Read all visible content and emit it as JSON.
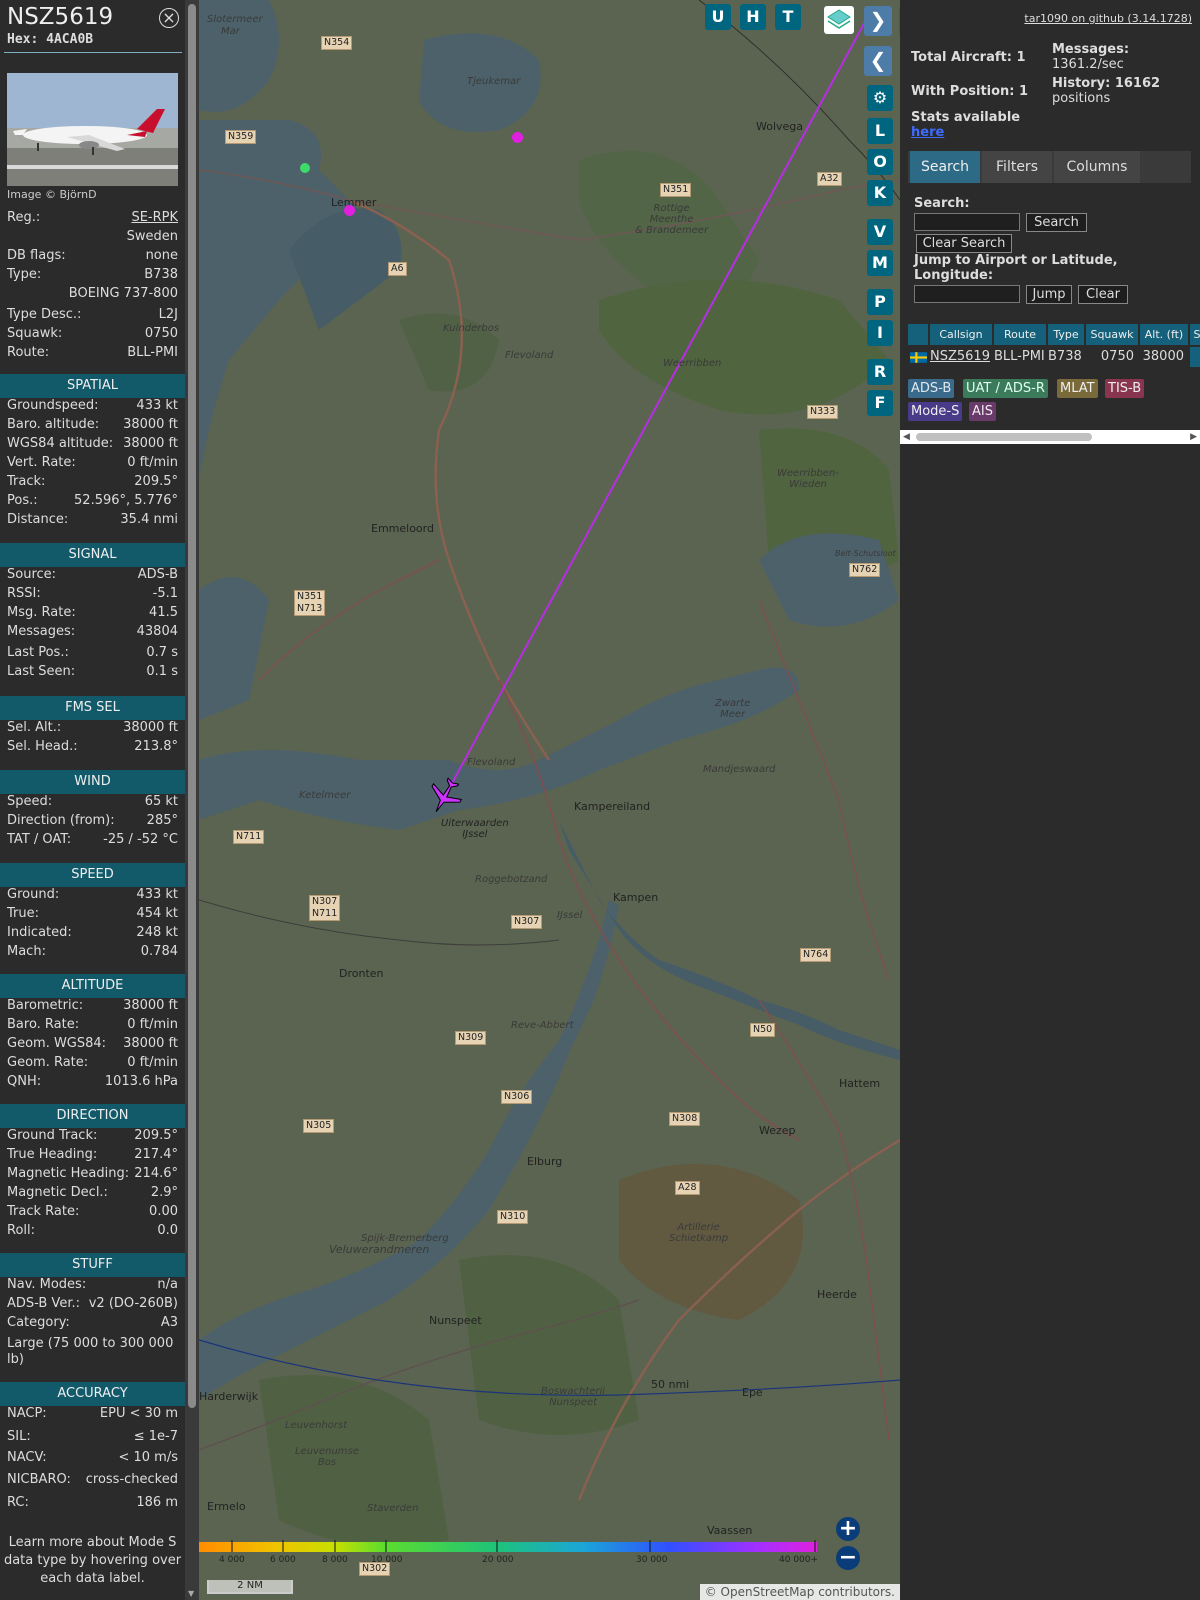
{
  "aircraft": {
    "callsign": "NSZ5619",
    "hex_label": "Hex: 4ACA0B",
    "image_credit": "Image © BjörnD",
    "close_icon": "circle-x-icon"
  },
  "info_rows": [
    {
      "k": "Reg.:",
      "v": "SE-RPK"
    },
    {
      "k": "",
      "v": "Sweden"
    },
    {
      "k": "DB flags:",
      "v": "none"
    },
    {
      "k": "Type:",
      "v": "B738"
    },
    {
      "k": "",
      "v": "BOEING 737-800"
    },
    {
      "k": "Type Desc.:",
      "v": "L2J"
    },
    {
      "k": "Squawk:",
      "v": "0750"
    },
    {
      "k": "Route:",
      "v": "BLL-PMI"
    }
  ],
  "sections": {
    "spatial": {
      "title": "SPATIAL",
      "rows": [
        {
          "k": "Groundspeed:",
          "v": "433 kt"
        },
        {
          "k": "Baro. altitude:",
          "v": "38000 ft"
        },
        {
          "k": "WGS84 altitude:",
          "v": "38000 ft"
        },
        {
          "k": "Vert. Rate:",
          "v": "0 ft/min"
        },
        {
          "k": "Track:",
          "v": "209.5°"
        },
        {
          "k": "Pos.:",
          "v": "52.596°, 5.776°"
        },
        {
          "k": "Distance:",
          "v": "35.4 nmi"
        }
      ]
    },
    "signal": {
      "title": "SIGNAL",
      "rows": [
        {
          "k": "Source:",
          "v": "ADS-B"
        },
        {
          "k": "RSSI:",
          "v": "-5.1"
        },
        {
          "k": "Msg. Rate:",
          "v": "41.5"
        },
        {
          "k": "Messages:",
          "v": "43804"
        },
        {
          "k": "Last Pos.:",
          "v": "0.7 s"
        },
        {
          "k": "Last Seen:",
          "v": "0.1 s"
        }
      ]
    },
    "fms": {
      "title": "FMS SEL",
      "rows": [
        {
          "k": "Sel. Alt.:",
          "v": "38000 ft"
        },
        {
          "k": "Sel. Head.:",
          "v": "213.8°"
        }
      ]
    },
    "wind": {
      "title": "WIND",
      "rows": [
        {
          "k": "Speed:",
          "v": "65 kt"
        },
        {
          "k": "Direction (from):",
          "v": "285°"
        },
        {
          "k": "TAT / OAT:",
          "v": "-25 / -52 °C"
        }
      ]
    },
    "speed": {
      "title": "SPEED",
      "rows": [
        {
          "k": "Ground:",
          "v": "433 kt"
        },
        {
          "k": "True:",
          "v": "454 kt"
        },
        {
          "k": "Indicated:",
          "v": "248 kt"
        },
        {
          "k": "Mach:",
          "v": "0.784"
        }
      ]
    },
    "altitude": {
      "title": "ALTITUDE",
      "rows": [
        {
          "k": "Barometric:",
          "v": "38000 ft"
        },
        {
          "k": "Baro. Rate:",
          "v": "0 ft/min"
        },
        {
          "k": "Geom. WGS84:",
          "v": "38000 ft"
        },
        {
          "k": "Geom. Rate:",
          "v": "0 ft/min"
        },
        {
          "k": "QNH:",
          "v": "1013.6 hPa"
        }
      ]
    },
    "direction": {
      "title": "DIRECTION",
      "rows": [
        {
          "k": "Ground Track:",
          "v": "209.5°"
        },
        {
          "k": "True Heading:",
          "v": "217.4°"
        },
        {
          "k": "Magnetic Heading:",
          "v": "214.6°"
        },
        {
          "k": "Magnetic Decl.:",
          "v": "2.9°"
        },
        {
          "k": "Track Rate:",
          "v": "0.00"
        },
        {
          "k": "Roll:",
          "v": "0.0"
        }
      ]
    },
    "stuff": {
      "title": "STUFF",
      "rows": [
        {
          "k": "Nav. Modes:",
          "v": "n/a"
        },
        {
          "k": "ADS-B Ver.:",
          "v": "v2 (DO-260B)"
        },
        {
          "k": "Category:",
          "v": "A3"
        }
      ],
      "category_desc": "Large (75 000 to 300 000 lb)"
    },
    "accuracy": {
      "title": "ACCURACY",
      "rows": [
        {
          "k": "NACP:",
          "v": "EPU < 30 m"
        },
        {
          "k": "SIL:",
          "v": "≤ 1e-7"
        },
        {
          "k": "NACV:",
          "v": "< 10 m/s"
        },
        {
          "k": "NICBARO:",
          "v": "cross-checked"
        },
        {
          "k": "RC:",
          "v": "186 m"
        }
      ]
    }
  },
  "footnote": "Learn more about Mode S data type by hovering over each data label.",
  "map": {
    "buttons": [
      "U",
      "H",
      "T",
      "L",
      "O",
      "K",
      "V",
      "M",
      "P",
      "I",
      "R",
      "F"
    ],
    "layers_icon": "layers-icon",
    "nav_next_icon": "chevron-right-icon",
    "nav_prev_icon": "chevron-left-icon",
    "expand_icon": "expand-horizontal-icon",
    "settings_icon": "gear-icon",
    "zoom_in_icon": "plus-icon",
    "zoom_out_icon": "minus-icon",
    "aircraft_icon": "airplane-icon",
    "range_ring_label": "50 nmi",
    "scale_label": "2 NM",
    "attribution": "© OpenStreetMap contributors.",
    "attribution_link": "OpenStreetMap",
    "altitude_scale": [
      "4 000",
      "6 000",
      "8 000",
      "10 000",
      "20 000",
      "30 000",
      "40 000+"
    ],
    "places": [
      "Slotermeer",
      "Mar",
      "Tjeukemar",
      "Wolvega",
      "Lemmer",
      "Kuinderbos",
      "Flevoland",
      "Weerribben",
      "Rottige Meenthe & Brandemeer",
      "Weerribben-Wieden",
      "Emmeloord",
      "Belt-Schutsloot",
      "Zwarte Meer",
      "Mandjeswaard",
      "Ketelmeer",
      "Uiterwaarden IJssel",
      "Kampereiland",
      "Roggebotzand",
      "Kampen",
      "Dronten",
      "Reve-Abbert",
      "Elburg",
      "Wezep",
      "Hattem",
      "Spijk-Bremerberg",
      "Veluwerandmeren",
      "Artillerie Schietkamp",
      "Heerde",
      "Nunspeet",
      "Boswachterij Nunspeet",
      "Epe",
      "Harderwijk",
      "Leuvenhorst",
      "Leuvenumse Bos",
      "Staverden",
      "Ermelo",
      "Vaassen",
      "Flevoland",
      "IJssel"
    ],
    "roads": [
      "N354",
      "N359",
      "A6",
      "N351",
      "A32",
      "N333",
      "N762",
      "N351 N713",
      "N711",
      "N307 N711",
      "N307",
      "N764",
      "N309",
      "N306",
      "N50",
      "N305",
      "N308",
      "A28",
      "N310",
      "N302"
    ]
  },
  "stats": {
    "total_aircraft": "Total Aircraft: 1",
    "with_position": "With Position: 1",
    "messages_label": "Messages:",
    "messages_value": "1361.2/sec",
    "history_label": "History: 16162",
    "history_value": "positions",
    "stats_avail": "Stats available",
    "here": "here",
    "version": "tar1090 on github (3.14.1728)"
  },
  "tabs": {
    "search": "Search",
    "filters": "Filters",
    "columns": "Columns"
  },
  "search": {
    "label": "Search:",
    "input_value": "",
    "search_button": "Search",
    "clear_button": "Clear Search",
    "jump_label": "Jump to Airport or Latitude, Longitude:",
    "jump_input_value": "",
    "jump_button": "Jump",
    "jump_clear_button": "Clear"
  },
  "table": {
    "headers": [
      "",
      "Callsign",
      "Route",
      "Type",
      "Squawk",
      "Alt. (ft)",
      "S"
    ],
    "row": {
      "flag_icon": "sweden-flag-icon",
      "callsign": "NSZ5619",
      "route": "BLL-PMI",
      "type": "B738",
      "squawk": "0750",
      "alt": "38000"
    }
  },
  "legend": [
    "ADS-B",
    "UAT / ADS-R",
    "MLAT",
    "TIS-B",
    "Mode-S",
    "AIS"
  ],
  "colors": {
    "accent": "#006680",
    "section": "#125a6a",
    "track": "#cc33ff",
    "adsb": "#3a6b8c",
    "uat": "#3b7a5a",
    "mlat": "#7a6a3a",
    "tisb": "#8a3550",
    "modes": "#4a3a8a",
    "ais": "#6a3a6a"
  }
}
